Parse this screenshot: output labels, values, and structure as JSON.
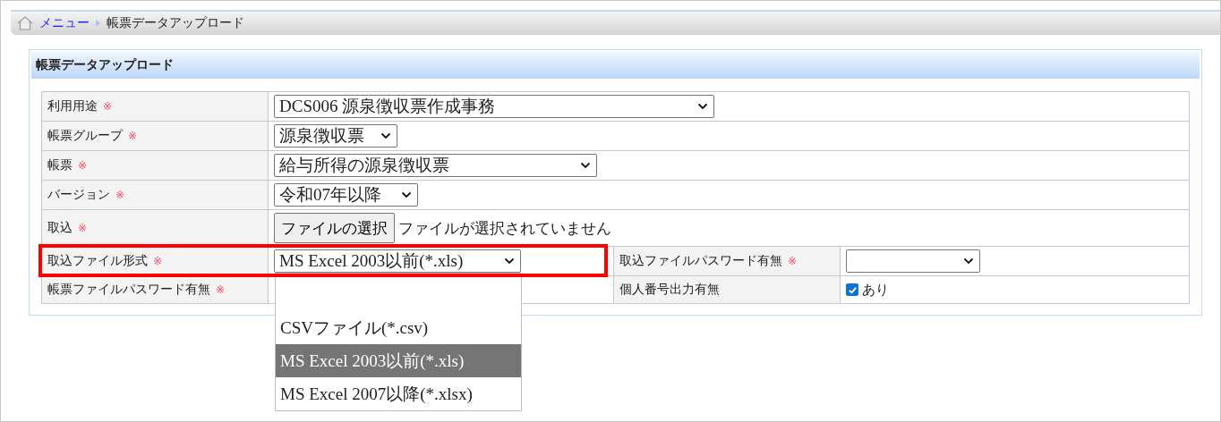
{
  "breadcrumb": [
    {
      "label": "メニュー",
      "kind": "link"
    },
    {
      "label": "帳票データアップロード",
      "kind": "current"
    }
  ],
  "panel": {
    "title": "帳票データアップロード"
  },
  "form": {
    "rows": [
      {
        "fields": [
          {
            "label": "利用用途",
            "mark": "※",
            "control": {
              "kind": "select",
              "value": "DCS006 源泉徴収票作成事務"
            }
          }
        ]
      },
      {
        "fields": [
          {
            "label": "帳票グループ",
            "mark": "※",
            "control": {
              "kind": "select",
              "value": "源泉徴収票"
            }
          }
        ]
      },
      {
        "fields": [
          {
            "label": "帳票",
            "mark": "※",
            "control": {
              "kind": "select",
              "value": "給与所得の源泉徴収票"
            }
          }
        ]
      },
      {
        "fields": [
          {
            "label": "バージョン",
            "mark": "※",
            "control": {
              "kind": "select",
              "value": "令和07年以降"
            }
          }
        ]
      },
      {
        "fields": [
          {
            "label": "取込",
            "mark": "※",
            "control": {
              "kind": "file",
              "button": "ファイルの選択",
              "status": "ファイルが選択されていません"
            }
          }
        ]
      },
      {
        "highlighted": true,
        "fields": [
          {
            "label": "取込ファイル形式",
            "mark": "※",
            "control": {
              "kind": "select",
              "value": "MS Excel 2003以前(*.xls)",
              "expanded": true,
              "options": [
                {
                  "selected": false
                },
                {
                  "label": "CSVファイル(*.csv)",
                  "selected": false
                },
                {
                  "label": "MS Excel 2003以前(*.xls)",
                  "selected": true
                },
                {
                  "label": "MS Excel 2007以降(*.xlsx)",
                  "selected": false
                }
              ]
            }
          },
          {
            "label": "取込ファイルパスワード有無",
            "mark": "※",
            "control": {
              "kind": "select"
            }
          }
        ]
      },
      {
        "fields": [
          {
            "label": "帳票ファイルパスワード有無",
            "mark": "※",
            "control": {
              "kind": "hidden"
            }
          },
          {
            "label": "個人番号出力有無",
            "control": {
              "kind": "checkbox",
              "checked": true,
              "text": "あり"
            }
          }
        ]
      }
    ]
  }
}
